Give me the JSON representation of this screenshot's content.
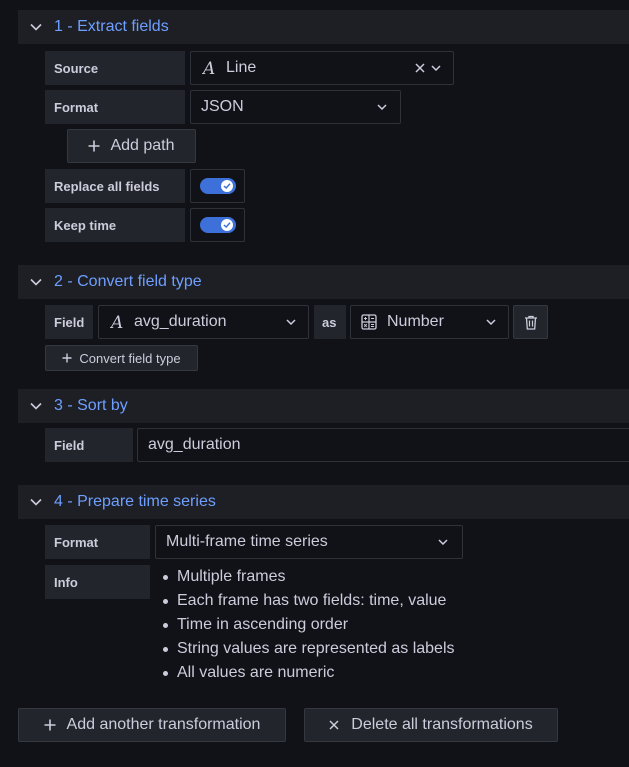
{
  "sections": [
    {
      "title": "1 - Extract fields"
    },
    {
      "title": "2 - Convert field type"
    },
    {
      "title": "3 - Sort by"
    },
    {
      "title": "4 - Prepare time series"
    }
  ],
  "extract": {
    "source_label": "Source",
    "source_value": "Line",
    "format_label": "Format",
    "format_value": "JSON",
    "add_path_label": "Add path",
    "replace_label": "Replace all fields",
    "replace_on": true,
    "keep_time_label": "Keep time",
    "keep_time_on": true
  },
  "convert": {
    "field_label": "Field",
    "field_value": "avg_duration",
    "as_label": "as",
    "type_value": "Number",
    "add_label": "Convert field type"
  },
  "sort": {
    "field_label": "Field",
    "field_value": "avg_duration"
  },
  "prepare": {
    "format_label": "Format",
    "format_value": "Multi-frame time series",
    "info_label": "Info",
    "info_items": [
      "Multiple frames",
      "Each frame has two fields: time, value",
      "Time in ascending order",
      "String values are represented as labels",
      "All values are numeric"
    ]
  },
  "footer": {
    "add_label": "Add another transformation",
    "delete_label": "Delete all transformations"
  },
  "colors": {
    "accent": "#6e9fff",
    "toggle": "#3d71d9",
    "background": "#111217"
  }
}
